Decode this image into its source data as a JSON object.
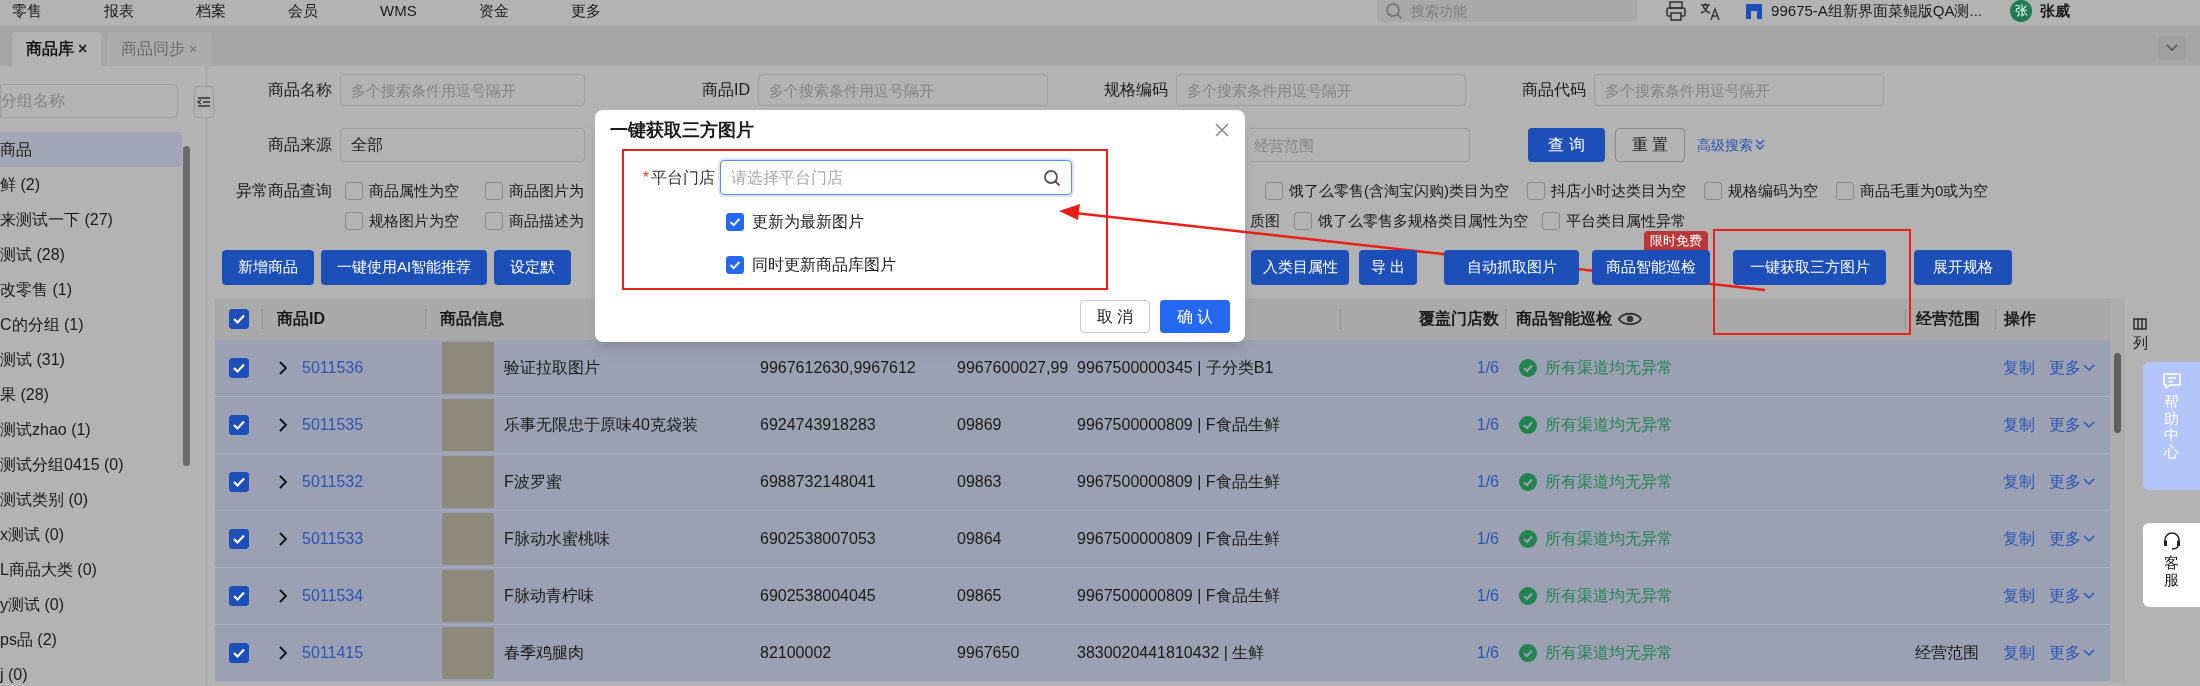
{
  "top_nav": {
    "menu": [
      "零售",
      "报表",
      "档案",
      "会员",
      "WMS",
      "资金",
      "更多"
    ],
    "search": {
      "placeholder": "搜索功能"
    },
    "store": "99675-A组新界面菜鲲版QA测...",
    "avatar": "张",
    "user": "张威"
  },
  "tabs": [
    {
      "label": "商品库",
      "close": "×",
      "selected": true
    },
    {
      "label": "商品同步",
      "close": "×",
      "selected": false
    }
  ],
  "sidebar": {
    "search": {
      "placeholder": "分组名称"
    },
    "groups": [
      {
        "label": "商品",
        "selected": true
      },
      {
        "label": "鲜 (2)",
        "selected": false
      },
      {
        "label": "来测试一下 (27)",
        "selected": false
      },
      {
        "label": "测试 (28)",
        "selected": false
      },
      {
        "label": "改零售 (1)",
        "selected": false
      },
      {
        "label": "C的分组 (1)",
        "selected": false
      },
      {
        "label": "测试 (31)",
        "selected": false
      },
      {
        "label": "果 (28)",
        "selected": false
      },
      {
        "label": "测试zhao (1)",
        "selected": false
      },
      {
        "label": "测试分组0415 (0)",
        "selected": false
      },
      {
        "label": "测试类别 (0)",
        "selected": false
      },
      {
        "label": "x测试 (0)",
        "selected": false
      },
      {
        "label": "L商品大类 (0)",
        "selected": false
      },
      {
        "label": "y测试 (0)",
        "selected": false
      },
      {
        "label": "ps品 (2)",
        "selected": false
      },
      {
        "label": "j (0)",
        "selected": false
      }
    ]
  },
  "filters": {
    "fields": [
      {
        "label": "商品名称",
        "placeholder": "多个搜索条件用逗号隔开"
      },
      {
        "label": "商品ID",
        "placeholder": "多个搜索条件用逗号隔开"
      },
      {
        "label": "规格编码",
        "placeholder": "多个搜索条件用逗号隔开"
      },
      {
        "label": "商品代码",
        "placeholder": "多个搜索条件用逗号隔开"
      }
    ],
    "source": {
      "label": "商品来源",
      "value": "全部"
    },
    "scope": {
      "placeholder": "经营范围"
    },
    "query": "查 询",
    "reset": "重 置",
    "advanced": "高级搜索"
  },
  "anomaly": {
    "label": "异常商品查询",
    "rows": [
      {
        "left": [
          {
            "label": "商品属性为空",
            "checked": false
          },
          {
            "label": "商品图片为",
            "checked": false
          }
        ],
        "right": [
          {
            "label": "饿了么零售(含淘宝闪购)类目为空",
            "checked": false
          },
          {
            "label": "抖店小时达类目为空",
            "checked": false
          },
          {
            "label": "规格编码为空",
            "checked": false
          },
          {
            "label": "商品毛重为0或为空",
            "checked": false
          }
        ]
      },
      {
        "left": [
          {
            "label": "规格图片为空",
            "checked": false
          },
          {
            "label": "商品描述为",
            "checked": false
          }
        ],
        "fragment": "质图",
        "right": [
          {
            "label": "饿了么零售多规格类目属性为空",
            "checked": false
          },
          {
            "label": "平台类目属性异常",
            "checked": false
          }
        ]
      }
    ]
  },
  "toolbar": {
    "left": [
      "新增商品",
      "一键使用AI智能推荐",
      "设定默"
    ],
    "right": [
      {
        "label": "入类目属性"
      },
      {
        "label": "导 出"
      },
      {
        "label": "自动抓取图片"
      },
      {
        "label": "商品智能巡检",
        "badge": "限时免费"
      },
      {
        "label": "一键获取三方图片"
      },
      {
        "label": "展开规格"
      }
    ]
  },
  "table": {
    "all_checked": true,
    "columns": {
      "id": "商品ID",
      "info": "商品信息",
      "stores": "覆盖门店数",
      "inspection": "商品智能巡检",
      "scope": "经营范围",
      "actions": "操作"
    },
    "column_settings": "列",
    "rows": [
      {
        "checked": true,
        "id": "5011536",
        "name": "验证拉取图片",
        "column_4": "9967612630,9967612",
        "column_5": "9967600027,99",
        "column_6": "9967500000345 | 子分类B1",
        "stores": "1/6",
        "inspection": "所有渠道均无异常",
        "copy": "复制",
        "more": "更多"
      },
      {
        "checked": true,
        "id": "5011535",
        "name": "乐事无限忠于原味40克袋装",
        "column_4": "6924743918283",
        "column_5": "09869",
        "column_6": "9967500000809 | F食品生鲜",
        "stores": "1/6",
        "inspection": "所有渠道均无异常",
        "copy": "复制",
        "more": "更多"
      },
      {
        "checked": true,
        "id": "5011532",
        "name": "F波罗蜜",
        "column_4": "6988732148041",
        "column_5": "09863",
        "column_6": "9967500000809 | F食品生鲜",
        "stores": "1/6",
        "inspection": "所有渠道均无异常",
        "copy": "复制",
        "more": "更多"
      },
      {
        "checked": true,
        "id": "5011533",
        "name": "F脉动水蜜桃味",
        "column_4": "6902538007053",
        "column_5": "09864",
        "column_6": "9967500000809 | F食品生鲜",
        "stores": "1/6",
        "inspection": "所有渠道均无异常",
        "copy": "复制",
        "more": "更多"
      },
      {
        "checked": true,
        "id": "5011534",
        "name": "F脉动青柠味",
        "column_4": "6902538004045",
        "column_5": "09865",
        "column_6": "9967500000809 | F食品生鲜",
        "stores": "1/6",
        "inspection": "所有渠道均无异常",
        "copy": "复制",
        "more": "更多"
      },
      {
        "checked": true,
        "id": "5011415",
        "name": "春季鸡腿肉",
        "column_4": "82100002",
        "column_5": "9967650",
        "column_6": "3830020441810432 | 生鲜",
        "stores": "1/6",
        "inspection": "所有渠道均无异常",
        "scope": "经营范围",
        "copy": "复制",
        "more": "更多"
      }
    ]
  },
  "modal": {
    "title": "一键获取三方图片",
    "store_field": {
      "required_mark": "*",
      "label": "平台门店",
      "placeholder": "请选择平台门店"
    },
    "options": [
      {
        "label": "更新为最新图片",
        "checked": true
      },
      {
        "label": "同时更新商品库图片",
        "checked": true
      }
    ],
    "cancel": "取 消",
    "confirm": "确 认"
  },
  "side_widgets": {
    "help": "帮助中心",
    "service": "客服"
  }
}
